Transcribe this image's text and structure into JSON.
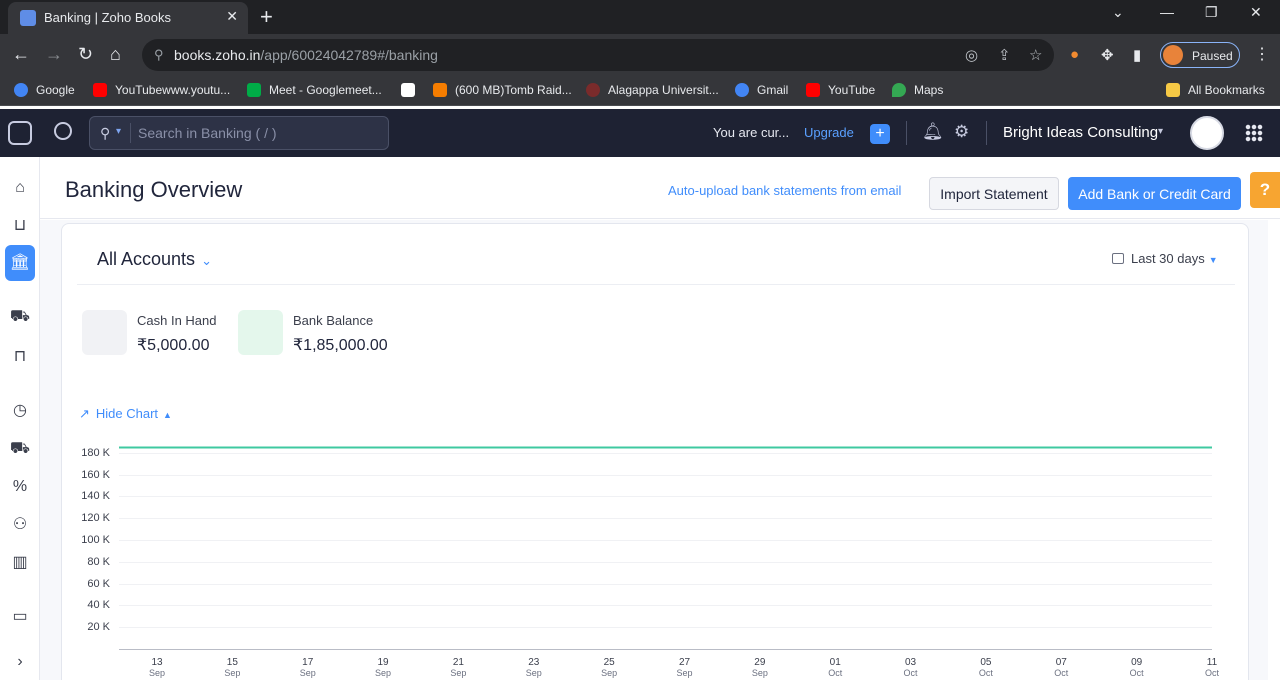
{
  "browser": {
    "tab_title": "Banking | Zoho Books",
    "url_host": "books.zoho.in",
    "url_path": "/app/60024042789#/banking",
    "profile_status": "Paused",
    "bookmarks": [
      "Google",
      "YouTubewww.youtu...",
      "Meet - Googlemeet...",
      "(600 MB)Tomb Raid...",
      "Alagappa Universit...",
      "Gmail",
      "YouTube",
      "Maps"
    ],
    "all_bookmarks": "All Bookmarks"
  },
  "app": {
    "search_placeholder": "Search in Banking ( / )",
    "trial_text": "You are cur...",
    "upgrade_label": "Upgrade",
    "org_name": "Bright Ideas Consulting"
  },
  "page": {
    "title": "Banking Overview",
    "auto_upload_label": "Auto-upload bank statements from email",
    "import_label": "Import Statement",
    "add_bank_label": "Add Bank or Credit Card",
    "help_label": "?"
  },
  "overview": {
    "accounts_label": "All Accounts",
    "range_label": "Last 30 days",
    "cash_label": "Cash In Hand",
    "cash_value": "₹5,000.00",
    "bank_label": "Bank Balance",
    "bank_value": "₹1,85,000.00",
    "hide_chart_label": "Hide Chart"
  },
  "colors": {
    "accent": "#408dfb",
    "header_bg": "#1e2233",
    "line_color": "#3fc9a0",
    "help_tab": "#f7a531"
  },
  "chart_data": {
    "type": "line",
    "y_ticks": [
      "180 K",
      "160 K",
      "140 K",
      "120 K",
      "100 K",
      "80 K",
      "60 K",
      "40 K",
      "20 K"
    ],
    "ylim": [
      0,
      190000
    ],
    "x_ticks": [
      {
        "day": "13",
        "mon": "Sep"
      },
      {
        "day": "15",
        "mon": "Sep"
      },
      {
        "day": "17",
        "mon": "Sep"
      },
      {
        "day": "19",
        "mon": "Sep"
      },
      {
        "day": "21",
        "mon": "Sep"
      },
      {
        "day": "23",
        "mon": "Sep"
      },
      {
        "day": "25",
        "mon": "Sep"
      },
      {
        "day": "27",
        "mon": "Sep"
      },
      {
        "day": "29",
        "mon": "Sep"
      },
      {
        "day": "01",
        "mon": "Oct"
      },
      {
        "day": "03",
        "mon": "Oct"
      },
      {
        "day": "05",
        "mon": "Oct"
      },
      {
        "day": "07",
        "mon": "Oct"
      },
      {
        "day": "09",
        "mon": "Oct"
      },
      {
        "day": "11",
        "mon": "Oct"
      }
    ],
    "series": [
      {
        "values": [
          185000,
          185000,
          185000,
          185000,
          185000,
          185000,
          185000,
          185000,
          185000,
          185000,
          185000,
          185000,
          185000,
          185000,
          185000
        ]
      }
    ],
    "grid": true
  }
}
